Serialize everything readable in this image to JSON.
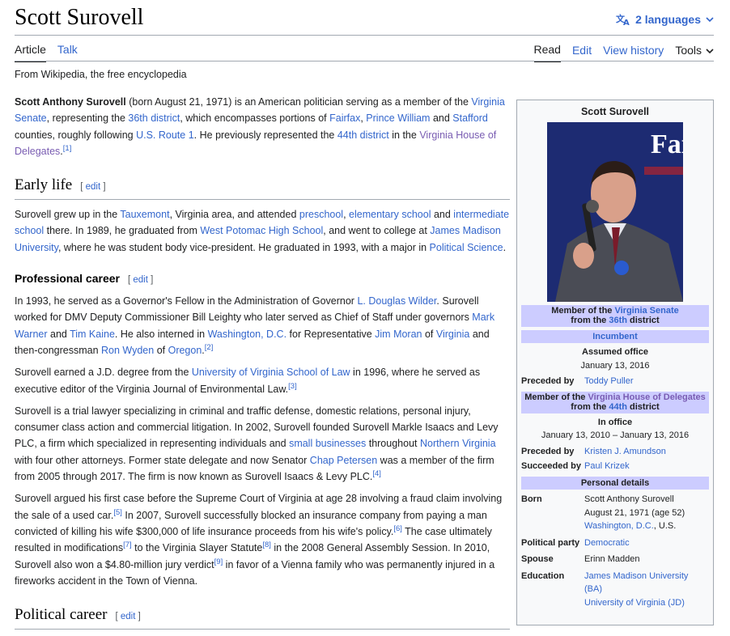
{
  "page": {
    "title": "Scott Surovell",
    "languages": "2 languages",
    "tabs_left": [
      "Article",
      "Talk"
    ],
    "tabs_right": [
      "Read",
      "Edit",
      "View history"
    ],
    "tools": "Tools",
    "tagline": "From Wikipedia, the free encyclopedia"
  },
  "colors": {
    "link": "#3366cc",
    "visited_link": "#795cb2",
    "infobox_header": "#ccccff"
  },
  "lead": {
    "name_bold": "Scott Anthony Surovell",
    "t1": " (born August 21, 1971) is an American politician serving as a member of the ",
    "l1": "Virginia Senate",
    "t2": ", representing the ",
    "l2": "36th district",
    "t3": ", which encompasses portions of ",
    "l3": "Fairfax",
    "t4": ", ",
    "l4": "Prince William",
    "t5": " and ",
    "l5": "Stafford",
    "t6": " counties, roughly following ",
    "l6": "U.S. Route 1",
    "t7": ". He previously represented the ",
    "l7": "44th district",
    "t8": " in the ",
    "l8": "Virginia House of Delegates",
    "t9": ".",
    "r1": "[1]"
  },
  "early_life": {
    "heading": "Early life",
    "edit": "edit",
    "t1": "Surovell grew up in the ",
    "l1": "Tauxemont",
    "t2": ", Virginia area, and attended ",
    "l2": "preschool",
    "t3": ", ",
    "l3": "elementary school",
    "t4": " and ",
    "l4": "intermediate school",
    "t5": " there. In 1989, he graduated from ",
    "l5": "West Potomac High School",
    "t6": ", and went to college at ",
    "l6": "James Madison University",
    "t7": ", where he was student body vice-president. He graduated in 1993, with a major in ",
    "l7": "Political Science",
    "t8": "."
  },
  "professional_career": {
    "heading": "Professional career",
    "edit": "edit",
    "p1": {
      "t1": "In 1993, he served as a Governor's Fellow in the Administration of Governor ",
      "l1": "L. Douglas Wilder",
      "t2": ". Surovell worked for DMV Deputy Commissioner Bill Leighty who later served as Chief of Staff under governors ",
      "l2": "Mark Warner",
      "t3": " and ",
      "l3": "Tim Kaine",
      "t4": ". He also interned in ",
      "l4": "Washington, D.C.",
      "t5": " for Representative ",
      "l5": "Jim Moran",
      "t6": " of ",
      "l6": "Virginia",
      "t7": " and then-congressman ",
      "l7": "Ron Wyden",
      "t8": " of ",
      "l8": "Oregon",
      "t9": ".",
      "r1": "[2]"
    },
    "p2": {
      "t1": "Surovell earned a J.D. degree from the ",
      "l1": "University of Virginia School of Law",
      "t2": " in 1996, where he served as executive editor of the Virginia Journal of Environmental Law.",
      "r1": "[3]"
    },
    "p3": {
      "t1": "Surovell is a trial lawyer specializing in criminal and traffic defense, domestic relations, personal injury, consumer class action and commercial litigation. In 2002, Surovell founded Surovell Markle Isaacs and Levy PLC, a firm which specialized in representing individuals and ",
      "l1": "small businesses",
      "t2": " throughout ",
      "l2": "Northern Virginia",
      "t3": " with four other attorneys. Former state delegate and now Senator ",
      "l3": "Chap Petersen",
      "t4": " was a member of the firm from 2005 through 2017. The firm is now known as Surovell Isaacs & Levy PLC.",
      "r1": "[4]"
    },
    "p4": {
      "t1": "Surovell argued his first case before the Supreme Court of Virginia at age 28 involving a fraud claim involving the sale of a used car.",
      "r1": "[5]",
      "t2": " In 2007, Surovell successfully blocked an insurance company from paying a man convicted of killing his wife $300,000 of life insurance proceeds from his wife's policy.",
      "r2": "[6]",
      "t3": " The case ultimately resulted in modifications",
      "r3": "[7]",
      "t4": " to the Virginia Slayer Statute",
      "r4": "[8]",
      "t5": " in the 2008 General Assembly Session. In 2010, Surovell also won a $4.80-million jury verdict",
      "r5": "[9]",
      "t6": " in favor of a Vienna family who was permanently injured in a fireworks accident in the Town of Vienna."
    }
  },
  "next_section": {
    "heading": "Political career",
    "edit": "edit"
  },
  "infobox": {
    "name": "Scott Surovell",
    "photo_text": "Fai De",
    "senate": {
      "member_of": "Member of the ",
      "body_link": "Virginia Senate",
      "from_the": "from the ",
      "district_link": "36th",
      "district": " district",
      "status": "Incumbent",
      "assumed_label": "Assumed office",
      "assumed_date": "January 13, 2016",
      "preceded_label": "Preceded by",
      "preceded_by": "Toddy Puller"
    },
    "house": {
      "member_of": "Member of the ",
      "body_link": "Virginia House of Delegates",
      "from_the": "from the ",
      "district_link": "44th",
      "district": " district",
      "office_label": "In office",
      "office_dates": "January 13, 2010 – January 13, 2016",
      "preceded_label": "Preceded by",
      "preceded_by": "Kristen J. Amundson",
      "succeeded_label": "Succeeded by",
      "succeeded_by": "Paul Krizek"
    },
    "personal": {
      "header": "Personal details",
      "born_label": "Born",
      "born_name": "Scott Anthony Surovell",
      "born_date": "August 21, 1971 (age 52)",
      "born_place_link": "Washington, D.C.",
      "born_place_rest": ", U.S.",
      "party_label": "Political party",
      "party": "Democratic",
      "spouse_label": "Spouse",
      "spouse": "Erinn Madden",
      "education_label": "Education",
      "edu1": "James Madison University",
      "edu1_deg": "(BA)",
      "edu2": "University of Virginia (JD)"
    }
  }
}
